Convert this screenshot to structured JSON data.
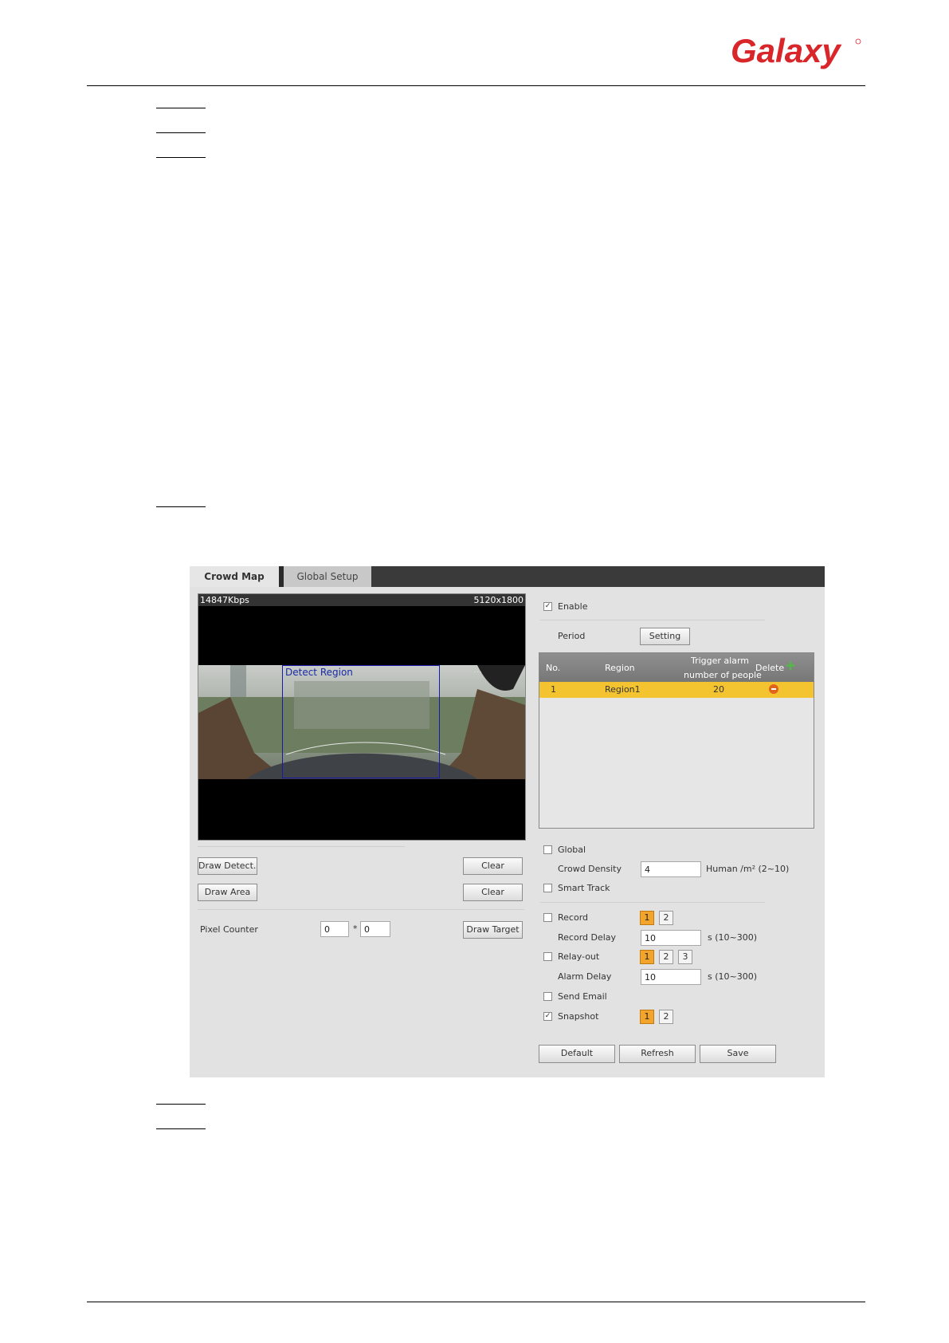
{
  "brand": {
    "logo_text": "Galaxy"
  },
  "ui": {
    "tabs": [
      {
        "label": "Crowd Map",
        "active": true
      },
      {
        "label": "Global Setup",
        "active": false
      }
    ],
    "video": {
      "bitrate": "14847Kbps",
      "resolution": "5120x1800",
      "detect_region_label": "Detect Region"
    },
    "left_controls": {
      "draw_detect_label": "Draw Detect...",
      "draw_area_label": "Draw Area",
      "clear_label": "Clear",
      "clear2_label": "Clear",
      "pixel_counter_label": "Pixel Counter",
      "pixel_w": "0",
      "pixel_h": "0",
      "pixel_sep": "*",
      "draw_target_label": "Draw Target"
    },
    "enable": {
      "label": "Enable",
      "checked": true
    },
    "period": {
      "label": "Period",
      "button": "Setting"
    },
    "table": {
      "headers": [
        "No.",
        "Region",
        "Trigger alarm",
        "number of people",
        "Delete"
      ],
      "rows": [
        {
          "no": "1",
          "region": "Region1",
          "trigger": "20"
        }
      ]
    },
    "global": {
      "label": "Global",
      "checked": false
    },
    "crowd_density": {
      "label": "Crowd Density",
      "value": "4",
      "unit": "Human /m² (2~10)"
    },
    "smart_track": {
      "label": "Smart Track",
      "checked": false
    },
    "record": {
      "label": "Record",
      "checked": false,
      "channels": [
        "1",
        "2"
      ]
    },
    "record_delay": {
      "label": "Record Delay",
      "value": "10",
      "unit": "s (10~300)"
    },
    "relay_out": {
      "label": "Relay-out",
      "checked": false,
      "channels": [
        "1",
        "2",
        "3"
      ]
    },
    "alarm_delay": {
      "label": "Alarm Delay",
      "value": "10",
      "unit": "s (10~300)"
    },
    "send_email": {
      "label": "Send Email",
      "checked": false
    },
    "snapshot": {
      "label": "Snapshot",
      "checked": true,
      "channels": [
        "1",
        "2"
      ]
    },
    "footer": {
      "default_label": "Default",
      "refresh_label": "Refresh",
      "save_label": "Save"
    },
    "colors": {
      "accent_orange": "#f2a52a",
      "row_highlight": "#f3c430",
      "tab_bar": "#3a3a3a",
      "brand_red": "#d8262a"
    }
  }
}
